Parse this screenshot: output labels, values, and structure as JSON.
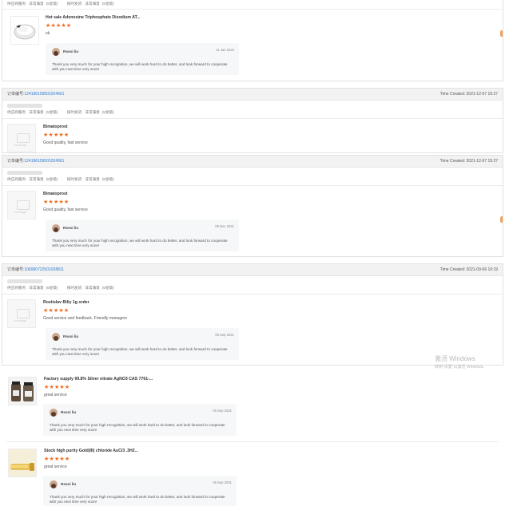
{
  "ratings_labels": {
    "supplier": "供应商服务:",
    "supplier_val": "非常满意",
    "shipping": "按时发货:",
    "shipping_val": "非常满意",
    "score": "(5星级)"
  },
  "sections": [
    {
      "product_title": "Hot sale Adenosine Triphosphate Disodium AT...",
      "comment": "ok",
      "reply": {
        "name": "Rossi liu",
        "date": "11 Jan 2022",
        "text": "Thank you very much for your high recognition, we will work hard to do better, and look forward to cooperate with you next time very soon!"
      }
    },
    {
      "order_label": "订单编号:",
      "order_number": "124196159501024561",
      "time": "Time Created: 2021-12-07 15:27",
      "product_title": "Bimatoprost",
      "comment": "Good quality, fast service",
      "thumb_text": "No Image"
    },
    {
      "order_label": "订单编号:",
      "order_number": "124196159501024561",
      "time": "Time Created: 2021-12-07 15:27",
      "product_title": "Bimatoprost",
      "comment": "Good quality, fast service",
      "thumb_text": "No Image",
      "reply": {
        "name": "Rossi liu",
        "date": "09 Dec 2021",
        "text": "Thank you very much for your high recognition, we will work hard to do better, and look forward to cooperate with you next time very soon!"
      }
    },
    {
      "order_label": "订单编号:",
      "order_number": "106990722501028811",
      "time": "Time Created: 2021-09-06 10:19",
      "product_title": "Rostislav Biliy 1g order",
      "comment": "Good service and feedback. Friendly managers",
      "thumb_text": "No Image",
      "reply": {
        "name": "Rossi liu",
        "date": "06 Sep 2021",
        "text": "Thank you very much for your high recognition, we will work hard to do better, and look forward to cooperate with you next time very soon!"
      }
    },
    {
      "product_title": "Factory supply 99.8% Silver nitrate AgNO3 CAS 7761-...",
      "comment": "great service",
      "reply": {
        "name": "Rossi liu",
        "date": "06 Sep 2021",
        "text": "Thank you very much for your high recognition, we will work hard to do better, and look forward to cooperate with you next time very soon!"
      }
    },
    {
      "product_title": "Stock high purity Gold(III) chloride AuCl3 .3H2...",
      "comment": "great service",
      "reply": {
        "name": "Rossi liu",
        "date": "06 Sep 2021",
        "text": "Thank you very much for your high recognition, we will work hard to do better, and look forward to cooperate with you next time very soon!"
      }
    }
  ],
  "stars": "★★★★★",
  "rating_value": 5,
  "watermark": {
    "line1": "激活 Windows",
    "line2": "转到\"设置\"以激活 Windows。"
  },
  "colors": {
    "star": "#f06d1f",
    "link": "#2a7ad4",
    "header_bg": "#f2f2f2"
  }
}
